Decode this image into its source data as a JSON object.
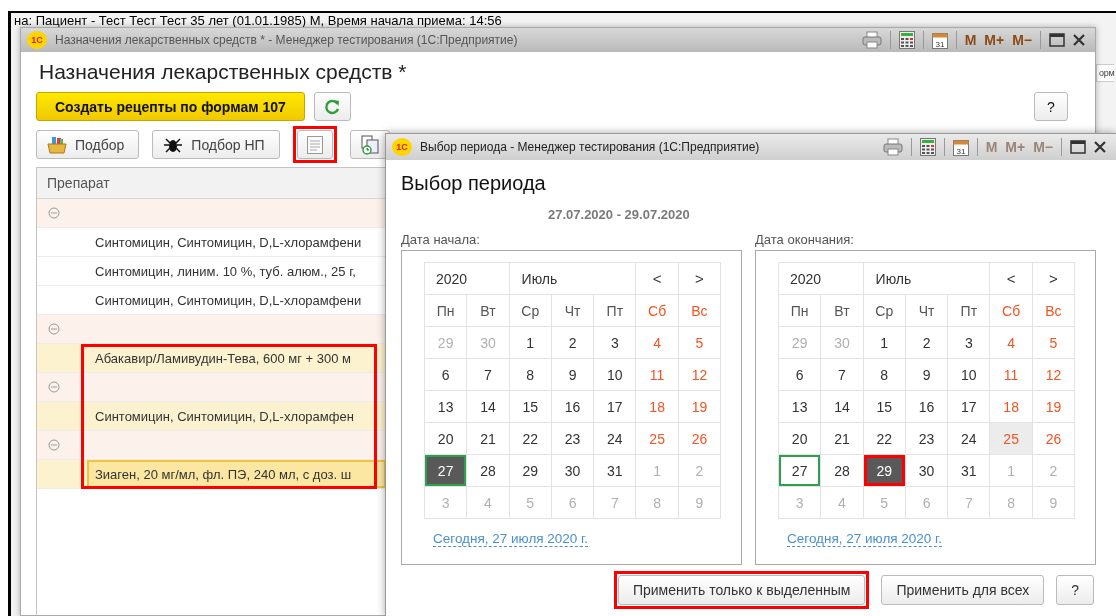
{
  "background": {
    "header_text": "на: Пациент - Тест Тест Тест 35 лет (01.01.1985) М, Время начала приема: 14:56",
    "edge_fragment": "орм"
  },
  "main_window": {
    "logo": "1С",
    "title": "Назначения лекарственных средств *  - Менеджер тестирования (1С:Предприятие)",
    "title_tools": [
      {
        "kind": "print"
      },
      {
        "kind": "calculator"
      },
      {
        "kind": "calendar",
        "label": "31"
      }
    ],
    "memory_buttons": [
      {
        "label": "M",
        "disabled": false
      },
      {
        "label": "M+",
        "disabled": false
      },
      {
        "label": "M−",
        "disabled": false
      }
    ],
    "window_buttons": [
      {
        "kind": "maximize"
      },
      {
        "kind": "close"
      }
    ],
    "heading": "Назначения лекарственных средств *",
    "primary_button": "Создать рецепты по формам 107",
    "help_button": "?",
    "toolbar": [
      {
        "kind": "picker",
        "label": "Подбор",
        "outlined": false
      },
      {
        "kind": "bug",
        "label": "Подбор НП",
        "outlined": false
      },
      {
        "kind": "document",
        "outlined": true
      },
      {
        "kind": "copy",
        "outlined": false
      }
    ],
    "table": {
      "columns": [
        "Препарат"
      ],
      "rows": [
        {
          "kind": "group",
          "expanded": true,
          "selected": false
        },
        {
          "kind": "item",
          "text": "Синтомицин, Синтомицин, D,L-хлорамфени",
          "highlighted": false,
          "selected": false,
          "outlined": false
        },
        {
          "kind": "item",
          "text": "Синтомицин, линим. 10 %, туб. алюм., 25 г,",
          "highlighted": false,
          "selected": false,
          "outlined": false
        },
        {
          "kind": "item",
          "text": "Синтомицин, Синтомицин, D,L-хлорамфени",
          "highlighted": false,
          "selected": false,
          "outlined": false
        },
        {
          "kind": "group",
          "expanded": true,
          "selected": false
        },
        {
          "kind": "item",
          "text": "Абакавир/Ламивудин-Тева, 600 мг + 300 м",
          "highlighted": true,
          "selected": false,
          "outlined": true
        },
        {
          "kind": "group",
          "expanded": true,
          "selected": false
        },
        {
          "kind": "item",
          "text": "Синтомицин, Синтомицин, D,L-хлорамфен",
          "highlighted": true,
          "selected": false,
          "outlined": true
        },
        {
          "kind": "group",
          "expanded": true,
          "selected": false
        },
        {
          "kind": "item",
          "text": "Зиаген, 20 мг/мл, фл. ПЭ, 240 мл, с доз. ш",
          "highlighted": true,
          "selected": true,
          "outlined": true
        }
      ]
    }
  },
  "dialog": {
    "logo": "1С",
    "title": "Выбор периода  - Менеджер тестирования (1С:Предприятие)",
    "title_tools": [
      {
        "kind": "print"
      },
      {
        "kind": "calculator"
      },
      {
        "kind": "calendar",
        "label": "31"
      }
    ],
    "memory_buttons": [
      {
        "label": "M",
        "disabled": true
      },
      {
        "label": "M+",
        "disabled": true
      },
      {
        "label": "M−",
        "disabled": true
      }
    ],
    "window_buttons": [
      {
        "kind": "maximize"
      },
      {
        "kind": "close"
      }
    ],
    "heading": "Выбор периода",
    "range": "27.07.2020 - 29.07.2020",
    "calendars": [
      {
        "label": "Дата начала:",
        "year": "2020",
        "month": "Июль",
        "prev": "<",
        "next": ">",
        "day_names": [
          {
            "text": "Пн",
            "weekend": false
          },
          {
            "text": "Вт",
            "weekend": false
          },
          {
            "text": "Ср",
            "weekend": false
          },
          {
            "text": "Чт",
            "weekend": false
          },
          {
            "text": "Пт",
            "weekend": false
          },
          {
            "text": "Сб",
            "weekend": true
          },
          {
            "text": "Вс",
            "weekend": true
          }
        ],
        "weeks": [
          [
            {
              "day": "29",
              "muted": true,
              "selected": false,
              "today": false,
              "hover": false,
              "outlined": false
            },
            {
              "day": "30",
              "muted": true,
              "selected": false,
              "today": false,
              "hover": false,
              "outlined": false
            },
            {
              "day": "1",
              "muted": false,
              "selected": false,
              "today": false,
              "hover": false,
              "outlined": false
            },
            {
              "day": "2",
              "muted": false,
              "selected": false,
              "today": false,
              "hover": false,
              "outlined": false
            },
            {
              "day": "3",
              "muted": false,
              "selected": false,
              "today": false,
              "hover": false,
              "outlined": false
            },
            {
              "day": "4",
              "muted": false,
              "selected": false,
              "today": false,
              "hover": false,
              "outlined": false
            },
            {
              "day": "5",
              "muted": false,
              "selected": false,
              "today": false,
              "hover": false,
              "outlined": false
            }
          ],
          [
            {
              "day": "6",
              "muted": false,
              "selected": false,
              "today": false,
              "hover": false,
              "outlined": false
            },
            {
              "day": "7",
              "muted": false,
              "selected": false,
              "today": false,
              "hover": false,
              "outlined": false
            },
            {
              "day": "8",
              "muted": false,
              "selected": false,
              "today": false,
              "hover": false,
              "outlined": false
            },
            {
              "day": "9",
              "muted": false,
              "selected": false,
              "today": false,
              "hover": false,
              "outlined": false
            },
            {
              "day": "10",
              "muted": false,
              "selected": false,
              "today": false,
              "hover": false,
              "outlined": false
            },
            {
              "day": "11",
              "muted": false,
              "selected": false,
              "today": false,
              "hover": false,
              "outlined": false
            },
            {
              "day": "12",
              "muted": false,
              "selected": false,
              "today": false,
              "hover": false,
              "outlined": false
            }
          ],
          [
            {
              "day": "13",
              "muted": false,
              "selected": false,
              "today": false,
              "hover": false,
              "outlined": false
            },
            {
              "day": "14",
              "muted": false,
              "selected": false,
              "today": false,
              "hover": false,
              "outlined": false
            },
            {
              "day": "15",
              "muted": false,
              "selected": false,
              "today": false,
              "hover": false,
              "outlined": false
            },
            {
              "day": "16",
              "muted": false,
              "selected": false,
              "today": false,
              "hover": false,
              "outlined": false
            },
            {
              "day": "17",
              "muted": false,
              "selected": false,
              "today": false,
              "hover": false,
              "outlined": false
            },
            {
              "day": "18",
              "muted": false,
              "selected": false,
              "today": false,
              "hover": false,
              "outlined": false
            },
            {
              "day": "19",
              "muted": false,
              "selected": false,
              "today": false,
              "hover": false,
              "outlined": false
            }
          ],
          [
            {
              "day": "20",
              "muted": false,
              "selected": false,
              "today": false,
              "hover": false,
              "outlined": false
            },
            {
              "day": "21",
              "muted": false,
              "selected": false,
              "today": false,
              "hover": false,
              "outlined": false
            },
            {
              "day": "22",
              "muted": false,
              "selected": false,
              "today": false,
              "hover": false,
              "outlined": false
            },
            {
              "day": "23",
              "muted": false,
              "selected": false,
              "today": false,
              "hover": false,
              "outlined": false
            },
            {
              "day": "24",
              "muted": false,
              "selected": false,
              "today": false,
              "hover": false,
              "outlined": false
            },
            {
              "day": "25",
              "muted": false,
              "selected": false,
              "today": false,
              "hover": false,
              "outlined": false
            },
            {
              "day": "26",
              "muted": false,
              "selected": false,
              "today": false,
              "hover": false,
              "outlined": false
            }
          ],
          [
            {
              "day": "27",
              "muted": false,
              "selected": true,
              "today": true,
              "hover": false,
              "outlined": false
            },
            {
              "day": "28",
              "muted": false,
              "selected": false,
              "today": false,
              "hover": false,
              "outlined": false
            },
            {
              "day": "29",
              "muted": false,
              "selected": false,
              "today": false,
              "hover": false,
              "outlined": false
            },
            {
              "day": "30",
              "muted": false,
              "selected": false,
              "today": false,
              "hover": false,
              "outlined": false
            },
            {
              "day": "31",
              "muted": false,
              "selected": false,
              "today": false,
              "hover": false,
              "outlined": false
            },
            {
              "day": "1",
              "muted": true,
              "selected": false,
              "today": false,
              "hover": false,
              "outlined": false
            },
            {
              "day": "2",
              "muted": true,
              "selected": false,
              "today": false,
              "hover": false,
              "outlined": false
            }
          ],
          [
            {
              "day": "3",
              "muted": true,
              "selected": false,
              "today": false,
              "hover": false,
              "outlined": false
            },
            {
              "day": "4",
              "muted": true,
              "selected": false,
              "today": false,
              "hover": false,
              "outlined": false
            },
            {
              "day": "5",
              "muted": true,
              "selected": false,
              "today": false,
              "hover": false,
              "outlined": false
            },
            {
              "day": "6",
              "muted": true,
              "selected": false,
              "today": false,
              "hover": false,
              "outlined": false
            },
            {
              "day": "7",
              "muted": true,
              "selected": false,
              "today": false,
              "hover": false,
              "outlined": false
            },
            {
              "day": "8",
              "muted": true,
              "selected": false,
              "today": false,
              "hover": false,
              "outlined": false
            },
            {
              "day": "9",
              "muted": true,
              "selected": false,
              "today": false,
              "hover": false,
              "outlined": false
            }
          ]
        ],
        "today_link": "Сегодня, 27 июля 2020 г."
      },
      {
        "label": "Дата окончания:",
        "year": "2020",
        "month": "Июль",
        "prev": "<",
        "next": ">",
        "day_names": [
          {
            "text": "Пн",
            "weekend": false
          },
          {
            "text": "Вт",
            "weekend": false
          },
          {
            "text": "Ср",
            "weekend": false
          },
          {
            "text": "Чт",
            "weekend": false
          },
          {
            "text": "Пт",
            "weekend": false
          },
          {
            "text": "Сб",
            "weekend": true
          },
          {
            "text": "Вс",
            "weekend": true
          }
        ],
        "weeks": [
          [
            {
              "day": "29",
              "muted": true,
              "selected": false,
              "today": false,
              "hover": false,
              "outlined": false
            },
            {
              "day": "30",
              "muted": true,
              "selected": false,
              "today": false,
              "hover": false,
              "outlined": false
            },
            {
              "day": "1",
              "muted": false,
              "selected": false,
              "today": false,
              "hover": false,
              "outlined": false
            },
            {
              "day": "2",
              "muted": false,
              "selected": false,
              "today": false,
              "hover": false,
              "outlined": false
            },
            {
              "day": "3",
              "muted": false,
              "selected": false,
              "today": false,
              "hover": false,
              "outlined": false
            },
            {
              "day": "4",
              "muted": false,
              "selected": false,
              "today": false,
              "hover": false,
              "outlined": false
            },
            {
              "day": "5",
              "muted": false,
              "selected": false,
              "today": false,
              "hover": false,
              "outlined": false
            }
          ],
          [
            {
              "day": "6",
              "muted": false,
              "selected": false,
              "today": false,
              "hover": false,
              "outlined": false
            },
            {
              "day": "7",
              "muted": false,
              "selected": false,
              "today": false,
              "hover": false,
              "outlined": false
            },
            {
              "day": "8",
              "muted": false,
              "selected": false,
              "today": false,
              "hover": false,
              "outlined": false
            },
            {
              "day": "9",
              "muted": false,
              "selected": false,
              "today": false,
              "hover": false,
              "outlined": false
            },
            {
              "day": "10",
              "muted": false,
              "selected": false,
              "today": false,
              "hover": false,
              "outlined": false
            },
            {
              "day": "11",
              "muted": false,
              "selected": false,
              "today": false,
              "hover": false,
              "outlined": false
            },
            {
              "day": "12",
              "muted": false,
              "selected": false,
              "today": false,
              "hover": false,
              "outlined": false
            }
          ],
          [
            {
              "day": "13",
              "muted": false,
              "selected": false,
              "today": false,
              "hover": false,
              "outlined": false
            },
            {
              "day": "14",
              "muted": false,
              "selected": false,
              "today": false,
              "hover": false,
              "outlined": false
            },
            {
              "day": "15",
              "muted": false,
              "selected": false,
              "today": false,
              "hover": false,
              "outlined": false
            },
            {
              "day": "16",
              "muted": false,
              "selected": false,
              "today": false,
              "hover": false,
              "outlined": false
            },
            {
              "day": "17",
              "muted": false,
              "selected": false,
              "today": false,
              "hover": false,
              "outlined": false
            },
            {
              "day": "18",
              "muted": false,
              "selected": false,
              "today": false,
              "hover": false,
              "outlined": false
            },
            {
              "day": "19",
              "muted": false,
              "selected": false,
              "today": false,
              "hover": false,
              "outlined": false
            }
          ],
          [
            {
              "day": "20",
              "muted": false,
              "selected": false,
              "today": false,
              "hover": false,
              "outlined": false
            },
            {
              "day": "21",
              "muted": false,
              "selected": false,
              "today": false,
              "hover": false,
              "outlined": false
            },
            {
              "day": "22",
              "muted": false,
              "selected": false,
              "today": false,
              "hover": false,
              "outlined": false
            },
            {
              "day": "23",
              "muted": false,
              "selected": false,
              "today": false,
              "hover": false,
              "outlined": false
            },
            {
              "day": "24",
              "muted": false,
              "selected": false,
              "today": false,
              "hover": false,
              "outlined": false
            },
            {
              "day": "25",
              "muted": false,
              "selected": false,
              "today": false,
              "hover": true,
              "outlined": false
            },
            {
              "day": "26",
              "muted": false,
              "selected": false,
              "today": false,
              "hover": false,
              "outlined": false
            }
          ],
          [
            {
              "day": "27",
              "muted": false,
              "selected": false,
              "today": true,
              "hover": false,
              "outlined": false
            },
            {
              "day": "28",
              "muted": false,
              "selected": false,
              "today": false,
              "hover": false,
              "outlined": false
            },
            {
              "day": "29",
              "muted": false,
              "selected": true,
              "today": false,
              "hover": false,
              "outlined": true
            },
            {
              "day": "30",
              "muted": false,
              "selected": false,
              "today": false,
              "hover": false,
              "outlined": false
            },
            {
              "day": "31",
              "muted": false,
              "selected": false,
              "today": false,
              "hover": false,
              "outlined": false
            },
            {
              "day": "1",
              "muted": true,
              "selected": false,
              "today": false,
              "hover": false,
              "outlined": false
            },
            {
              "day": "2",
              "muted": true,
              "selected": false,
              "today": false,
              "hover": false,
              "outlined": false
            }
          ],
          [
            {
              "day": "3",
              "muted": true,
              "selected": false,
              "today": false,
              "hover": false,
              "outlined": false
            },
            {
              "day": "4",
              "muted": true,
              "selected": false,
              "today": false,
              "hover": false,
              "outlined": false
            },
            {
              "day": "5",
              "muted": true,
              "selected": false,
              "today": false,
              "hover": false,
              "outlined": false
            },
            {
              "day": "6",
              "muted": true,
              "selected": false,
              "today": false,
              "hover": false,
              "outlined": false
            },
            {
              "day": "7",
              "muted": true,
              "selected": false,
              "today": false,
              "hover": false,
              "outlined": false
            },
            {
              "day": "8",
              "muted": true,
              "selected": false,
              "today": false,
              "hover": false,
              "outlined": false
            },
            {
              "day": "9",
              "muted": true,
              "selected": false,
              "today": false,
              "hover": false,
              "outlined": false
            }
          ]
        ],
        "today_link": "Сегодня, 27 июля 2020 г."
      }
    ],
    "buttons": [
      {
        "label": "Применить только к выделенным",
        "outlined": true
      },
      {
        "label": "Применить для всех",
        "outlined": false
      },
      {
        "label": "?",
        "outlined": false
      }
    ]
  }
}
